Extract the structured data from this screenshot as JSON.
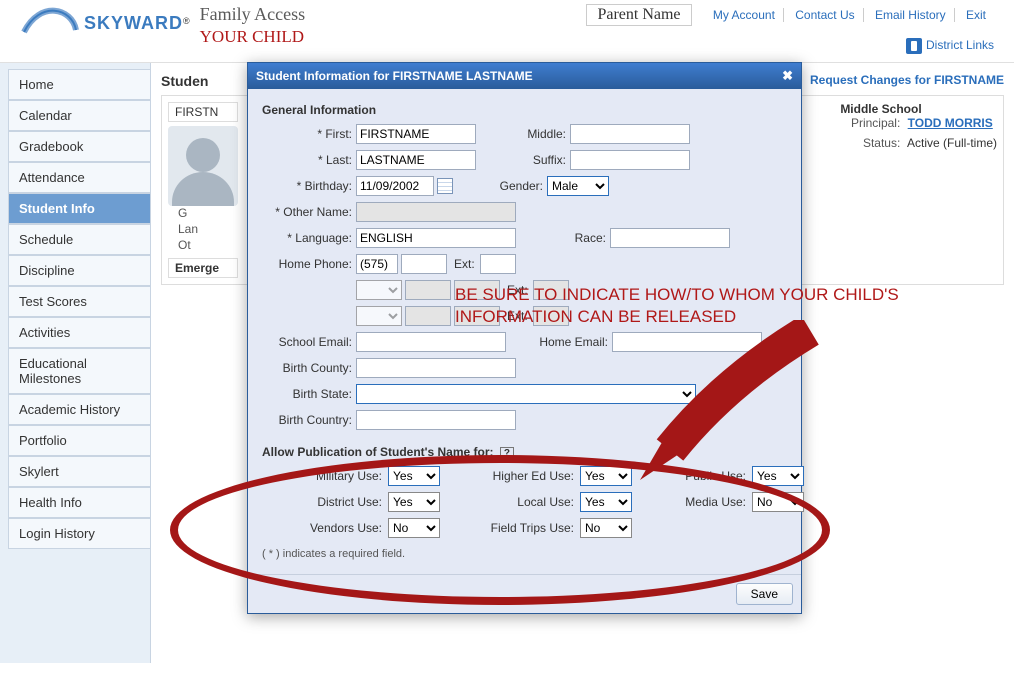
{
  "header": {
    "logo_text": "SKYWARD",
    "family_access": "Family Access",
    "your_child": "YOUR CHILD",
    "parent_name": "Parent Name",
    "links": {
      "my_account": "My Account",
      "contact_us": "Contact Us",
      "email_history": "Email History",
      "exit": "Exit",
      "district_links": "District Links"
    }
  },
  "sidebar": {
    "items": [
      {
        "label": "Home"
      },
      {
        "label": "Calendar"
      },
      {
        "label": "Gradebook"
      },
      {
        "label": "Attendance"
      },
      {
        "label": "Student Info"
      },
      {
        "label": "Schedule"
      },
      {
        "label": "Discipline"
      },
      {
        "label": "Test Scores"
      },
      {
        "label": "Activities"
      },
      {
        "label": "Educational Milestones"
      },
      {
        "label": "Academic History"
      },
      {
        "label": "Portfolio"
      },
      {
        "label": "Skylert"
      },
      {
        "label": "Health Info"
      },
      {
        "label": "Login History"
      }
    ],
    "selected_index": 4
  },
  "content": {
    "heading": "Studen",
    "firstname_crumbs": "FIRSTN",
    "request_link": "Request Changes for FIRSTNAME",
    "bg": {
      "g": "G",
      "lan": "Lan",
      "ot": "Ot",
      "emerge": "Emerge"
    },
    "school": {
      "school_name": "Middle School",
      "principal_label": "Principal:",
      "principal_name": "TODD MORRIS",
      "status_label": "Status:",
      "status_value": "Active (Full-time)"
    }
  },
  "modal": {
    "title": "Student Information for FIRSTNAME LASTNAME",
    "section_general": "General Information",
    "labels": {
      "first": "First:",
      "middle": "Middle:",
      "last": "Last:",
      "suffix": "Suffix:",
      "birthday": "Birthday:",
      "gender": "Gender:",
      "other_name": "Other Name:",
      "language": "Language:",
      "race": "Race:",
      "home_phone": "Home Phone:",
      "ext": "Ext:",
      "school_email": "School Email:",
      "home_email": "Home Email:",
      "birth_county": "Birth County:",
      "birth_state": "Birth State:",
      "birth_country": "Birth Country:"
    },
    "values": {
      "first": "FIRSTNAME",
      "middle": "",
      "last": "LASTNAME",
      "suffix": "",
      "birthday": "11/09/2002",
      "gender": "Male",
      "other_name": "",
      "language": "ENGLISH",
      "race": "",
      "area": "(575)",
      "phone2": "",
      "phone3": "",
      "ext1": "",
      "school_email": "",
      "home_email": "",
      "birth_county": "",
      "birth_state": "",
      "birth_country": ""
    },
    "pub": {
      "heading": "Allow Publication of Student's Name for:",
      "help": "?",
      "military_lbl": "Military Use:",
      "military": "Yes",
      "highered_lbl": "Higher Ed Use:",
      "highered": "Yes",
      "public_lbl": "Public Use:",
      "public": "Yes",
      "district_lbl": "District Use:",
      "district": "Yes",
      "local_lbl": "Local Use:",
      "local": "Yes",
      "media_lbl": "Media Use:",
      "media": "No",
      "vendors_lbl": "Vendors Use:",
      "vendors": "No",
      "trips_lbl": "Field Trips Use:",
      "trips": "No"
    },
    "req_note": "( * ) indicates a required field.",
    "save": "Save"
  },
  "annotation": {
    "text": "BE SURE TO INDICATE HOW/TO WHOM YOUR CHILD'S INFORMATION CAN BE RELEASED"
  }
}
